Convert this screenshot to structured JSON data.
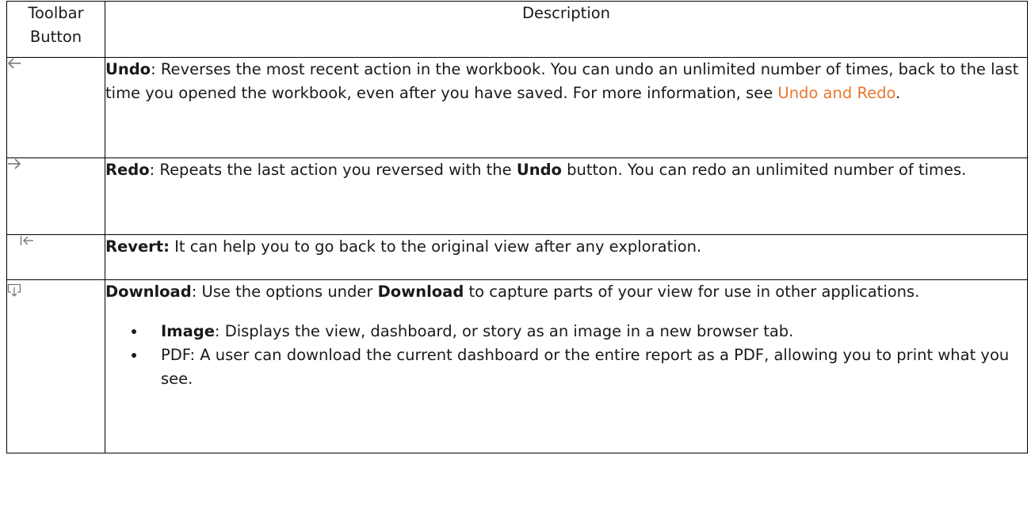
{
  "table": {
    "header": {
      "col1": "Toolbar Button",
      "col2": "Description"
    },
    "rows": [
      {
        "icon": "undo-arrow-icon",
        "name": "Undo",
        "sep": ": ",
        "text": "Reverses the most recent action in the workbook. You can undo an unlimited number of times, back to the last time you opened the workbook, even after you have saved. For more information, see ",
        "link": "Undo and Redo",
        "tail": "."
      },
      {
        "icon": "redo-arrow-icon",
        "name": "Redo",
        "sep": ": ",
        "text_a": "Repeats the last action you reversed with the ",
        "bold_inline": "Undo",
        "text_b": " button. You can redo an unlimited number of times."
      },
      {
        "icon": "revert-icon",
        "name": "Revert:",
        "text": " It can help you to go back to the original view after any exploration."
      },
      {
        "icon": "download-icon",
        "name": "Download",
        "sep": ": ",
        "text_a": "Use the options under ",
        "bold_inline": "Download",
        "text_b": " to capture parts of your view for use in other applications.",
        "options": [
          {
            "name": "Image",
            "text": ": Displays the view, dashboard, or story as an image in a new browser tab."
          },
          {
            "text": "PDF: A user can download the current dashboard or the entire report as a PDF, allowing you to print what you see."
          }
        ]
      }
    ]
  },
  "colors": {
    "link": "#e8772e",
    "icon": "#777777",
    "border": "#000000"
  }
}
